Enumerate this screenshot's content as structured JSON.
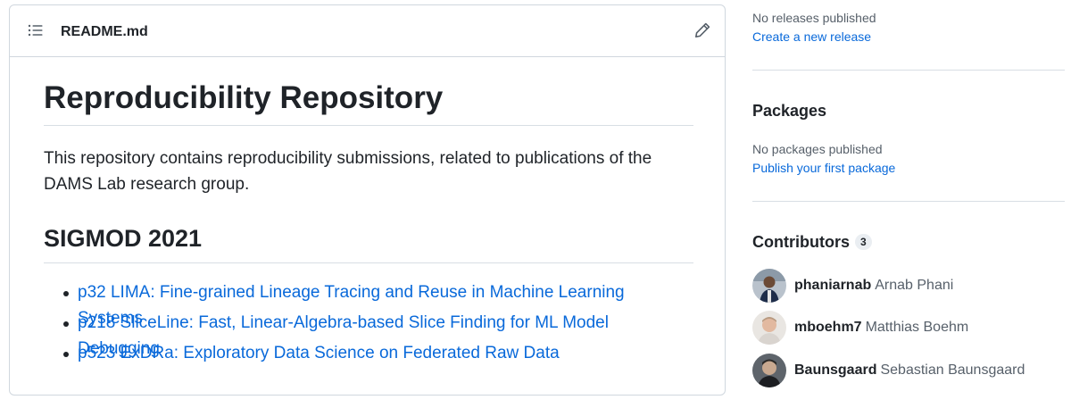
{
  "readme": {
    "filename": "README.md",
    "title": "Reproducibility Repository",
    "intro": "This repository contains reproducibility submissions, related to publications of the DAMS Lab research group.",
    "section": "SIGMOD 2021",
    "publications": [
      "p32 LIMA: Fine-grained Lineage Tracing and Reuse in Machine Learning Systems",
      "p218 SliceLine: Fast, Linear-Algebra-based Slice Finding for ML Model Debugging",
      "p523 ExDRa: Exploratory Data Science on Federated Raw Data"
    ]
  },
  "sidebar": {
    "releases": {
      "status": "No releases published",
      "link": "Create a new release"
    },
    "packages": {
      "title": "Packages",
      "status": "No packages published",
      "link": "Publish your first package"
    },
    "contributors": {
      "title": "Contributors",
      "count": "3",
      "items": [
        {
          "login": "phaniarnab",
          "name": "Arnab Phani"
        },
        {
          "login": "mboehm7",
          "name": "Matthias Boehm"
        },
        {
          "login": "Baunsgaard",
          "name": "Sebastian Baunsgaard"
        }
      ]
    }
  },
  "colors": {
    "link": "#0969da",
    "border": "#d0d7de",
    "text": "#1f2328",
    "muted": "#57606a"
  },
  "icons": [
    "list-unordered-icon",
    "pencil-icon"
  ]
}
